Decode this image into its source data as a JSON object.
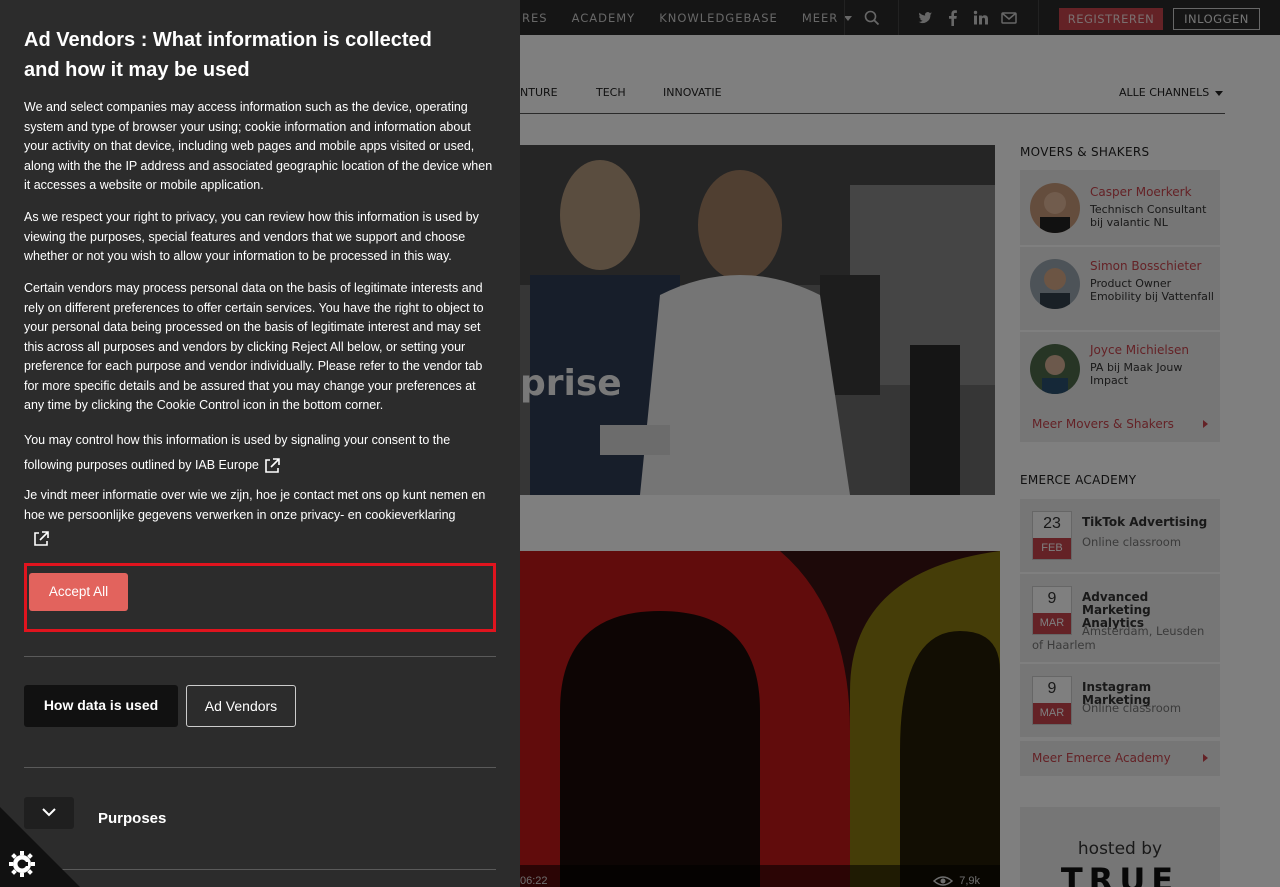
{
  "site": {
    "topnav": [
      {
        "label": "RES",
        "caret": false
      },
      {
        "label": "ACADEMY",
        "caret": false
      },
      {
        "label": "KNOWLEDGEBASE",
        "caret": false
      },
      {
        "label": "MEER",
        "caret": true
      }
    ],
    "register_label": "REGISTREREN",
    "login_label": "INLOGGEN",
    "channels": [
      "NTURE",
      "TECH",
      "INNOVATIE"
    ],
    "all_channels_label": "ALLE CHANNELS",
    "hero_title_fragment": "prise",
    "card2_time": "06:22",
    "card2_views": "7,9k",
    "movers": {
      "heading": "MOVERS & SHAKERS",
      "items": [
        {
          "name": "Casper Moerkerk",
          "role": "Technisch Consultant bij valantic NL"
        },
        {
          "name": "Simon Bosschieter",
          "role": "Product Owner Emobility bij Vattenfall"
        },
        {
          "name": "Joyce Michielsen",
          "role": "PA bij Maak Jouw Impact"
        }
      ],
      "more_label": "Meer Movers & Shakers"
    },
    "academy": {
      "heading": "EMERCE ACADEMY",
      "items": [
        {
          "day": "23",
          "month": "FEB",
          "title": "TikTok Advertising",
          "location": "Online classroom"
        },
        {
          "day": "9",
          "month": "MAR",
          "title": "Advanced Marketing Analytics",
          "location": "Amsterdam, Leusden of Haarlem"
        },
        {
          "day": "9",
          "month": "MAR",
          "title": "Instagram Marketing",
          "location": "Online classroom"
        }
      ],
      "more_label": "Meer Emerce Academy"
    },
    "ad": {
      "hosted_label": "hosted by",
      "brand": "TRUE"
    }
  },
  "consent": {
    "title": "Ad Vendors : What information is collected and how it may be used",
    "paragraphs": [
      "We and select companies may access information such as the device, operating system and type of browser your using; cookie information and information about your activity on that device, including web pages and mobile apps visited or used, along with the the IP address and associated geographic location of the device when it accesses a website or mobile application.",
      "As we respect your right to privacy, you can review how this information is used by viewing the purposes, special features and vendors that we support and choose whether or not you wish to allow your information to be processed in this way.",
      "Certain vendors may process personal data on the basis of legitimate interests and rely on different preferences to offer certain services. You have the right to object to your personal data being processed on the basis of legitimate interest and may set this across all purposes and vendors by clicking Reject All below, or setting your preference for each purpose and vendor individually. Please refer to the vendor tab for more specific details and be assured that you may change your preferences at any time by clicking the Cookie Control icon in the bottom corner.",
      "You may control how this information is used by signaling your consent to the following purposes outlined by IAB Europe",
      "Je vindt meer informatie over wie we zijn, hoe je contact met ons op kunt nemen en hoe we persoonlijke gegevens verwerken in onze privacy- en cookieverklaring"
    ],
    "accept_all_label": "Accept All",
    "tabs": [
      "How data is used",
      "Ad Vendors"
    ],
    "purposes_label": "Purposes"
  },
  "colors": {
    "accent": "#c9444d",
    "accept_button": "#e2635d",
    "highlight_border": "#e0141e",
    "panel_bg": "#2c2c2c"
  },
  "icons": [
    "search-icon",
    "twitter-icon",
    "facebook-icon",
    "linkedin-icon",
    "mail-icon",
    "external-link-icon",
    "chevron-down-icon",
    "cookie-control-icon",
    "eye-icon"
  ]
}
